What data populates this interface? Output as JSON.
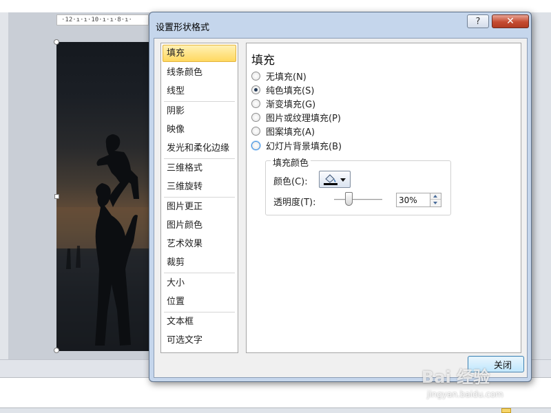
{
  "background": {
    "ruler_text": "·12·ı·ı·10·ı·ı·8·ı·",
    "photo_colors": {
      "sky_top": "#15191f",
      "sunset": "#5f4a37",
      "ground": "#121519"
    }
  },
  "dialog": {
    "title": "设置形状格式",
    "help_glyph": "?",
    "close_glyph": "✕",
    "categories": [
      {
        "label": "填充",
        "selected": true
      },
      {
        "label": "线条颜色",
        "selected": false
      },
      {
        "label": "线型",
        "selected": false
      },
      {
        "label": "阴影",
        "selected": false
      },
      {
        "label": "映像",
        "selected": false
      },
      {
        "label": "发光和柔化边缘",
        "selected": false
      },
      {
        "label": "三维格式",
        "selected": false
      },
      {
        "label": "三维旋转",
        "selected": false
      },
      {
        "label": "图片更正",
        "selected": false
      },
      {
        "label": "图片颜色",
        "selected": false
      },
      {
        "label": "艺术效果",
        "selected": false
      },
      {
        "label": "裁剪",
        "selected": false
      },
      {
        "label": "大小",
        "selected": false
      },
      {
        "label": "位置",
        "selected": false
      },
      {
        "label": "文本框",
        "selected": false
      },
      {
        "label": "可选文字",
        "selected": false
      }
    ],
    "panel": {
      "title": "填充",
      "options": [
        {
          "label": "无填充(N)",
          "checked": false
        },
        {
          "label": "纯色填充(S)",
          "checked": true
        },
        {
          "label": "渐变填充(G)",
          "checked": false
        },
        {
          "label": "图片或纹理填充(P)",
          "checked": false
        },
        {
          "label": "图案填充(A)",
          "checked": false
        },
        {
          "label": "幻灯片背景填充(B)",
          "checked": false
        }
      ],
      "fill_color_group": {
        "title": "填充颜色",
        "color_label": "颜色(C):",
        "color_value": "#000000",
        "transparency_label": "透明度(T):",
        "transparency_value": "30%",
        "transparency_fraction": 0.3
      }
    },
    "close_button_label": "关闭"
  },
  "watermark": {
    "text": "Bai 经验",
    "url": "jingyan.baidu.com"
  }
}
